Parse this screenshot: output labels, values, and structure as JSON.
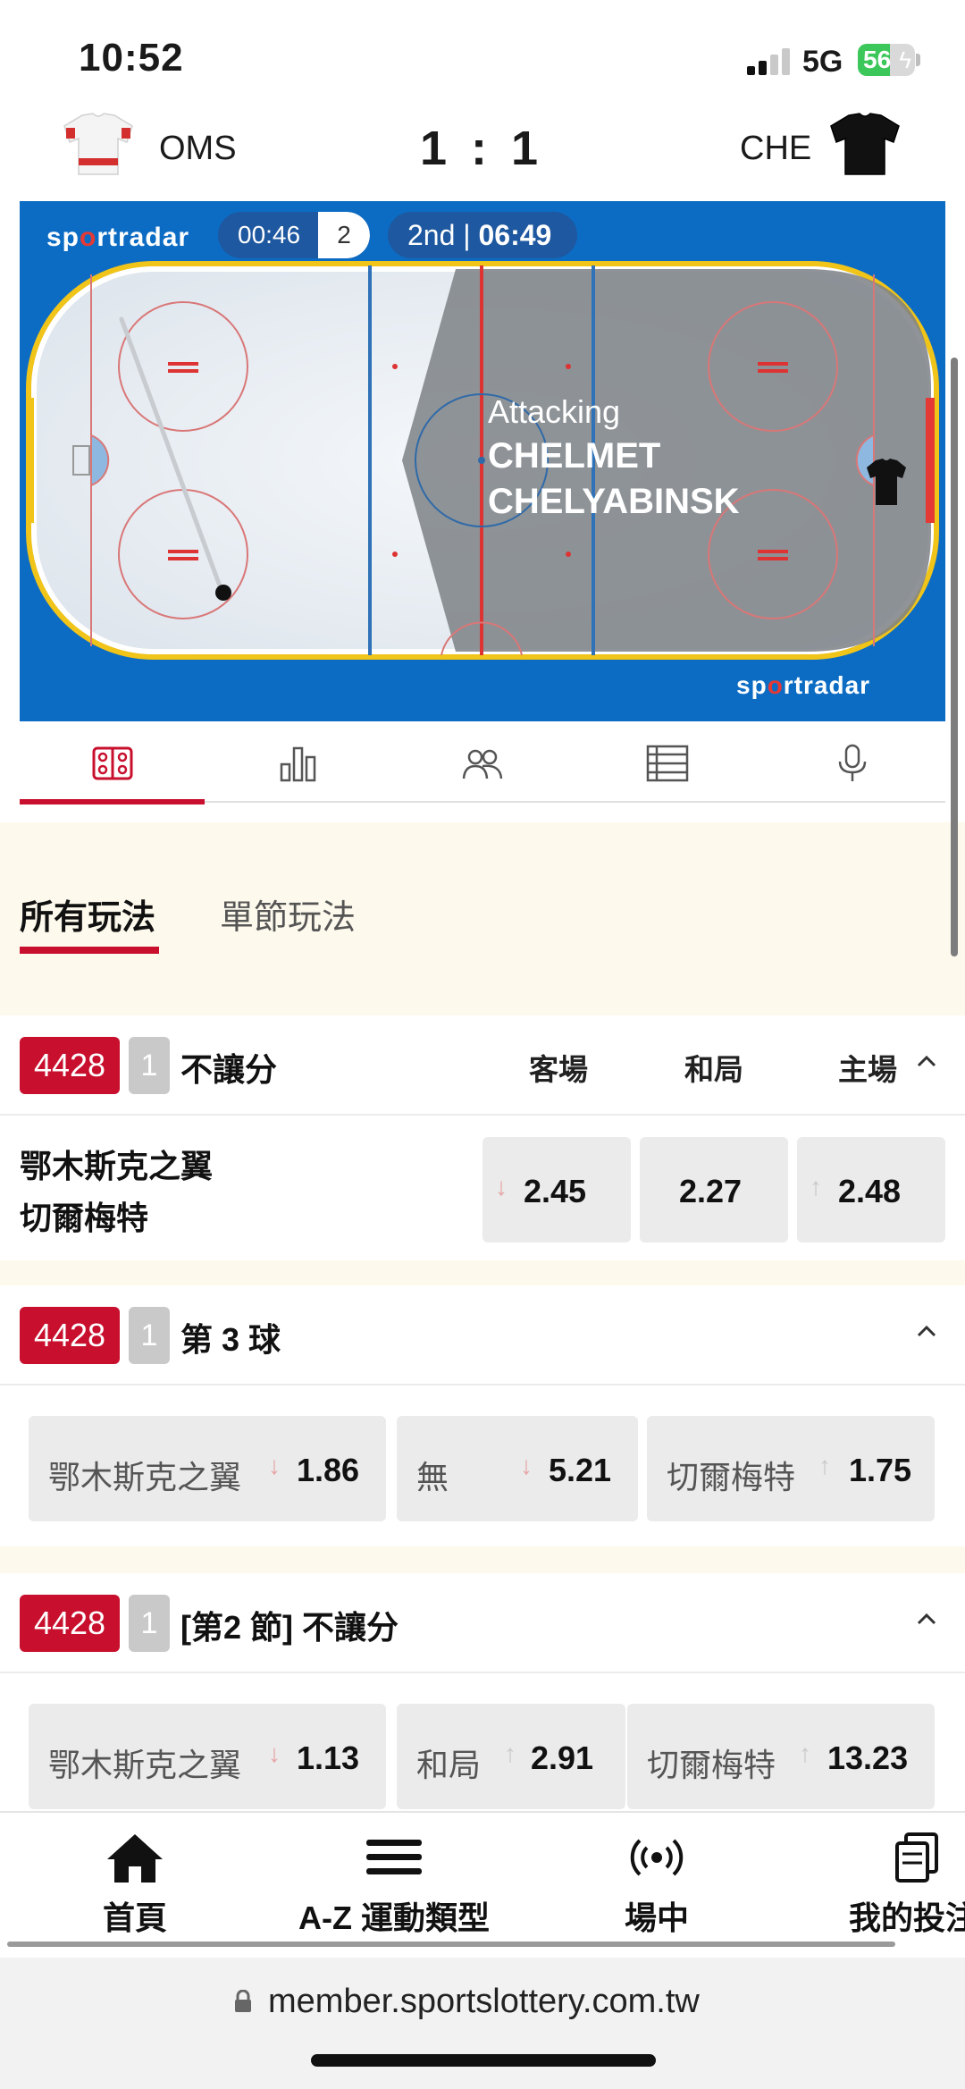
{
  "status": {
    "time": "10:52",
    "network": "5G",
    "battery": "56",
    "battery_level": 0.56
  },
  "match": {
    "home_team": "OMS",
    "away_team": "CHE",
    "score": "1 : 1"
  },
  "tracker": {
    "brand_prefix": "sp",
    "brand_o": "o",
    "brand_suffix": "rtradar",
    "clock": "00:46",
    "clock_period": "2",
    "period": "2nd",
    "period_time": "06:49",
    "attacking_label": "Attacking",
    "attacking_line1": "CHELMET",
    "attacking_line2": "CHELYABINSK"
  },
  "view_tabs": [
    {
      "icon": "rink-icon",
      "active": true
    },
    {
      "icon": "stats-icon",
      "active": false
    },
    {
      "icon": "lineups-icon",
      "active": false
    },
    {
      "icon": "table-icon",
      "active": false
    },
    {
      "icon": "commentary-icon",
      "active": false
    }
  ],
  "market_tabs": {
    "all": "所有玩法",
    "period": "單節玩法"
  },
  "markets": [
    {
      "code": "4428",
      "period": "1",
      "title": "不讓分",
      "columns": [
        "客場",
        "和局",
        "主場"
      ],
      "team_home": "鄂木斯克之翼",
      "team_away": "切爾梅特",
      "odds": [
        "2.45",
        "2.27",
        "2.48"
      ]
    },
    {
      "code": "4428",
      "period": "1",
      "title": "第 3 球",
      "options": [
        {
          "label": "鄂木斯克之翼",
          "odd": "1.86"
        },
        {
          "label": "無",
          "odd": "5.21"
        },
        {
          "label": "切爾梅特",
          "odd": "1.75"
        }
      ]
    },
    {
      "code": "4428",
      "period": "1",
      "title": "[第2 節] 不讓分",
      "options": [
        {
          "label": "鄂木斯克之翼",
          "odd": "1.13"
        },
        {
          "label": "和局",
          "odd": "2.91"
        },
        {
          "label": "切爾梅特",
          "odd": "13.23"
        }
      ]
    }
  ],
  "bottom_nav": [
    {
      "label": "首頁",
      "icon": "home-icon"
    },
    {
      "label": "A-Z 運動類型",
      "icon": "menu-icon"
    },
    {
      "label": "場中",
      "icon": "live-icon"
    },
    {
      "label": "我的投注",
      "icon": "copy-icon"
    }
  ],
  "browser": {
    "url": "member.sportslottery.com.tw"
  },
  "colors": {
    "accent": "#c8102e",
    "rink_blue": "#0c6cc4",
    "cream": "#fdf9ec",
    "odd_bg": "#ebebeb"
  }
}
